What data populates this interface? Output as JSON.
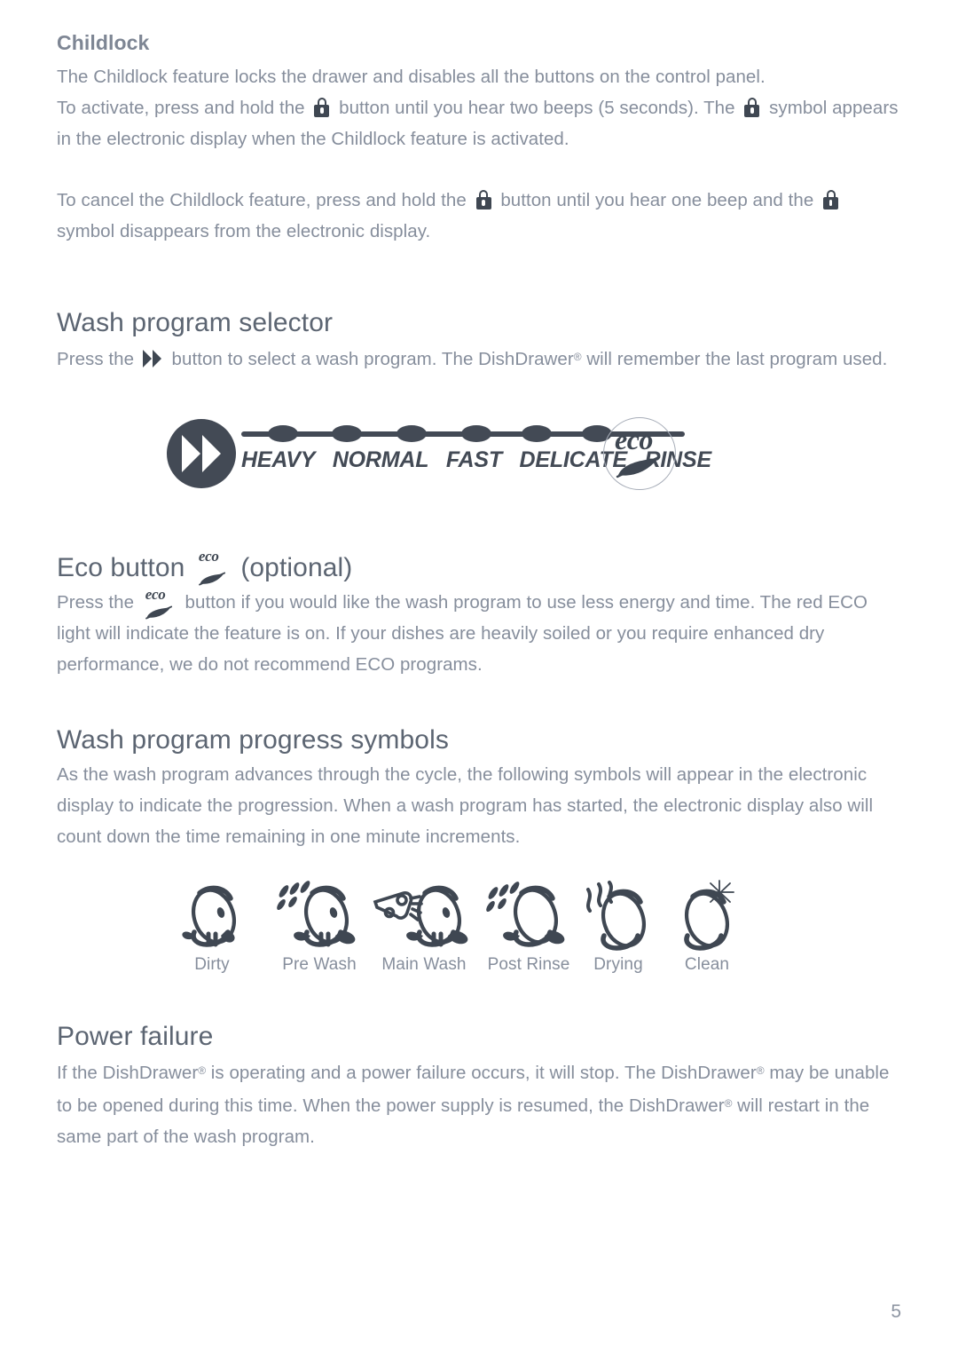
{
  "document": {
    "page_number": "5",
    "colors": {
      "body_text": "#868e9c",
      "heading": "#5c6572",
      "subheading": "#7e8694",
      "icon_dark": "#3f4752",
      "graphic_dark": "#434a55",
      "badge_outline": "#a7adb8",
      "page_background": "#ffffff"
    }
  },
  "childlock": {
    "heading": "Childlock",
    "para1_a": "The Childlock feature locks the drawer and disables all the buttons on the control panel.",
    "para1_b_pre": "To activate, press and hold the",
    "para1_b_mid": "button until you hear two beeps (5 seconds).  The",
    "para1_b_post": "symbol appears in the electronic display when the Childlock feature is activated.",
    "para2_pre": "To cancel the Childlock feature, press and hold the",
    "para2_mid": "button until you hear one beep and the",
    "para2_post": "symbol disappears from the electronic display.",
    "lock_icon_name": "padlock-icon"
  },
  "wash_program_selector": {
    "heading": "Wash program selector",
    "body_pre": "Press the",
    "body_mid": "button to select a wash program.  The DishDrawer",
    "body_reg": "®",
    "body_post": " will remember the last program used.",
    "graphic": {
      "button_icon_name": "double-chevron-icon",
      "programs": [
        "HEAVY",
        "NORMAL",
        "FAST",
        "DELICATE",
        "RINSE"
      ],
      "indicator_dot_count": 5,
      "extra_dot": true,
      "eco_badge_text": "eco",
      "eco_badge_icon_name": "eco-leaf-badge-icon"
    }
  },
  "eco_button": {
    "heading_pre": "Eco button",
    "heading_post": "(optional)",
    "icon_name": "eco-leaf-icon",
    "icon_text": "eco",
    "body_pre": "Press the",
    "body_post_1": "button if you would like the wash program to use less energy and time.  The red ECO light will indicate the feature is on.  If your dishes are heavily soiled or you require enhanced dry performance, we do not recommend ECO programs."
  },
  "progress_symbols": {
    "heading": "Wash program progress symbols",
    "body": "As the wash program advances through the cycle, the following symbols will appear in the electronic display to indicate the progression.  When a wash program has started, the electronic display also will count down the time remaining in one minute increments.",
    "items": [
      {
        "label": "Dirty",
        "icon_name": "dirty-plate-icon"
      },
      {
        "label": "Pre Wash",
        "icon_name": "pre-wash-plate-icon"
      },
      {
        "label": "Main Wash",
        "icon_name": "main-wash-plate-brush-icon"
      },
      {
        "label": "Post Rinse",
        "icon_name": "post-rinse-plate-icon"
      },
      {
        "label": "Drying",
        "icon_name": "drying-plate-icon"
      },
      {
        "label": "Clean",
        "icon_name": "clean-plate-sparkle-icon"
      }
    ]
  },
  "power_failure": {
    "heading": "Power failure",
    "body_1": "If the DishDrawer",
    "body_2": " is operating and a power failure occurs, it will stop.  The DishDrawer",
    "body_3": " may be unable to be opened during this time. When the power supply is resumed, the DishDrawer",
    "body_4": " will restart in the same part of the wash program.",
    "reg": "®"
  }
}
